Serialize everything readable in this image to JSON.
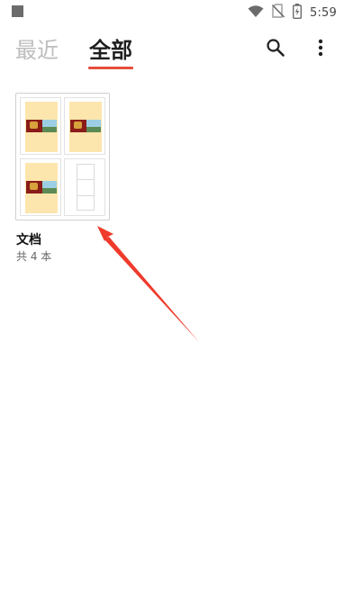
{
  "status_bar": {
    "time": "5:59",
    "icons": [
      "notification-square-icon",
      "wifi-icon",
      "no-sim-icon",
      "battery-charging-icon"
    ]
  },
  "header": {
    "tabs": [
      {
        "label": "最近",
        "active": false
      },
      {
        "label": "全部",
        "active": true
      }
    ],
    "accent_color": "#e74c3c",
    "actions": [
      "search-icon",
      "more-vert-icon"
    ]
  },
  "documents": [
    {
      "title": "文档",
      "count_label": "共 4 本"
    }
  ],
  "annotation": {
    "type": "arrow",
    "color": "#ef3b2c"
  }
}
